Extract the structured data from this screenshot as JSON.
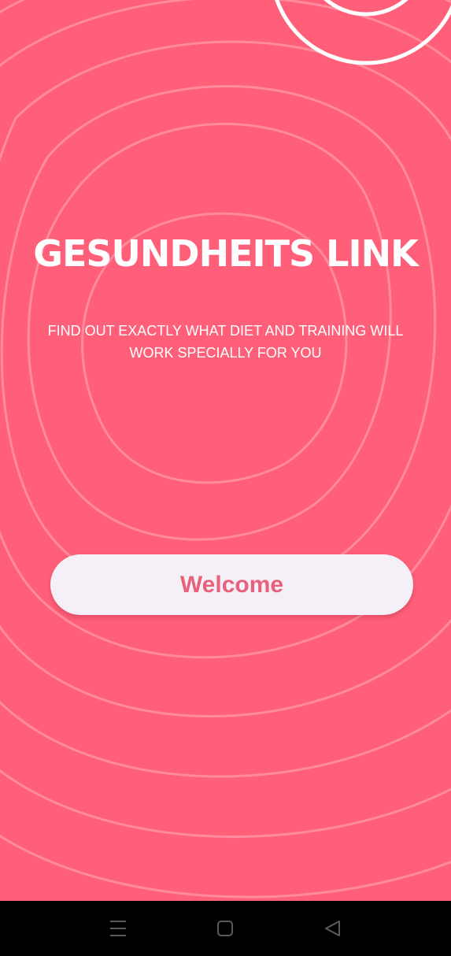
{
  "app": {
    "title": "GESUNDHEITS LINK",
    "tagline": "FIND OUT EXACTLY WHAT DIET AND TRAINING WILL WORK SPECIALLY FOR YOU",
    "welcome_label": "Welcome"
  },
  "colors": {
    "background": "#ff5f78",
    "button_bg": "#f5f0f8",
    "button_text": "#e8607a",
    "navbar": "#000000"
  },
  "navbar": {
    "icons": [
      "menu-icon",
      "home-square-icon",
      "back-triangle-icon"
    ]
  }
}
